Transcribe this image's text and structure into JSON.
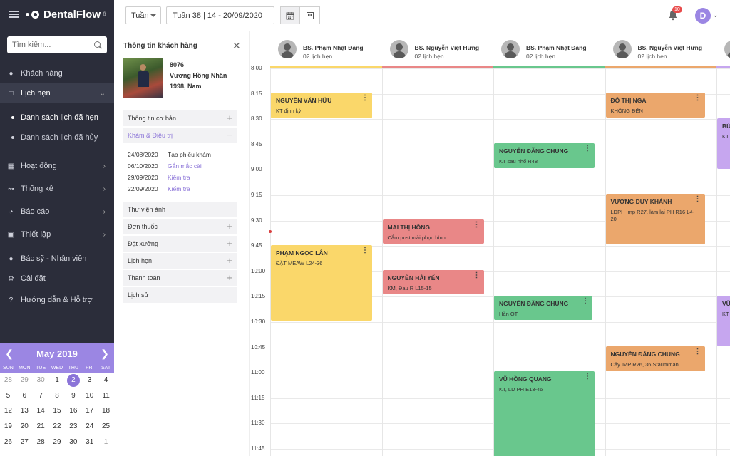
{
  "app": {
    "name": "DentalFlow",
    "reg": "®"
  },
  "search": {
    "placeholder": "Tìm kiếm..."
  },
  "nav": {
    "customers": "Khách hàng",
    "appointments": "Lịch hẹn",
    "sub_list": "Danh sách lịch đã hẹn",
    "sub_cancelled": "Danh sách lịch đã hủy",
    "activity": "Hoạt động",
    "stats": "Thống kê",
    "reports": "Báo cáo",
    "setup": "Thiết lập",
    "staff": "Bác sỹ - Nhân viên",
    "settings": "Cài đặt",
    "help": "Hướng dẫn & Hỗ trợ"
  },
  "mini_calendar": {
    "month": "May 2019",
    "dow": [
      "SUN",
      "MON",
      "TUE",
      "WED",
      "THU",
      "FRI",
      "SAT"
    ],
    "days": [
      "28",
      "29",
      "30",
      "1",
      "2",
      "3",
      "4",
      "5",
      "6",
      "7",
      "8",
      "9",
      "10",
      "11",
      "12",
      "13",
      "14",
      "15",
      "16",
      "17",
      "18",
      "19",
      "20",
      "21",
      "22",
      "23",
      "24",
      "25",
      "26",
      "27",
      "28",
      "29",
      "30",
      "31",
      "1"
    ],
    "selected": "2"
  },
  "topbar": {
    "view": "Tuần",
    "range": "Tuần 38 | 14 - 20/09/2020",
    "notif_count": "10",
    "user_initial": "D"
  },
  "customer": {
    "title": "Thông tin khách hàng",
    "id": "8076",
    "name": "Vương Hồng Nhân",
    "info": "1998, Nam",
    "sections": {
      "basic": "Thông tin cơ bản",
      "treatment": "Khám & Điều trị",
      "gallery": "Thư viện ảnh",
      "prescription": "Đơn thuốc",
      "lab": "Đặt xưởng",
      "appointments": "Lịch hẹn",
      "payment": "Thanh toán",
      "history": "Lịch sử"
    },
    "treatment_history": [
      {
        "date": "24/08/2020",
        "text": "Tạo phiếu khám"
      },
      {
        "date": "06/10/2020",
        "text": "Gắn mắc cài"
      },
      {
        "date": "29/09/2020",
        "text": "Kiểm tra"
      },
      {
        "date": "22/09/2020",
        "text": "Kiểm tra"
      }
    ]
  },
  "doctors": [
    {
      "name": "BS. Phạm Nhật Đăng",
      "count": "02 lịch hẹn",
      "color": "#fad76a"
    },
    {
      "name": "BS. Nguyễn Việt Hưng",
      "count": "02 lịch hẹn",
      "color": "#e98787"
    },
    {
      "name": "BS. Phạm Nhật Đăng",
      "count": "02 lịch hẹn",
      "color": "#69c78d"
    },
    {
      "name": "BS. Nguyễn Việt Hưng",
      "count": "02 lịch hẹn",
      "color": "#eba76c"
    },
    {
      "name": "",
      "count": "",
      "color": "#c6a6ef"
    }
  ],
  "times": [
    "8:00",
    "8:15",
    "8:30",
    "8:45",
    "9:00",
    "9:15",
    "9:30",
    "9:45",
    "10:00",
    "10:15",
    "10:30",
    "10:45",
    "11:00",
    "11:15",
    "11:30",
    "11:45"
  ],
  "appointments": [
    {
      "name": "NGUYỄN VĂN HỮU",
      "desc": "KT định kỳ"
    },
    {
      "name": "PHẠM NGỌC LÂN",
      "desc": "ĐẶT MEAW L24-36"
    },
    {
      "name": "MAI THỊ HỒNG",
      "desc": "Cắm post mài phục hình"
    },
    {
      "name": "NGUYỄN HẢI YẾN",
      "desc": "KM, Đau R L15-15"
    },
    {
      "name": "NGUYỄN ĐĂNG CHUNG",
      "desc": "KT sau nhổ R48"
    },
    {
      "name": "NGUYỄN ĐĂNG CHUNG",
      "desc": "Hàn OT"
    },
    {
      "name": "VŨ HỒNG QUANG",
      "desc": "KT, LD PH E13-46"
    },
    {
      "name": "ĐỖ THỊ NGA",
      "desc": "KHÔNG ĐẾN"
    },
    {
      "name": "VƯƠNG DUY KHÁNH",
      "desc": "LDPH Imp R27, làm lại PH R16 L4-20"
    },
    {
      "name": "NGUYỄN ĐĂNG CHUNG",
      "desc": "Cấy IMP R26, 36 Staumman"
    },
    {
      "name": "BÙ",
      "desc": "KT"
    },
    {
      "name": "VŨ",
      "desc": "KT"
    }
  ]
}
